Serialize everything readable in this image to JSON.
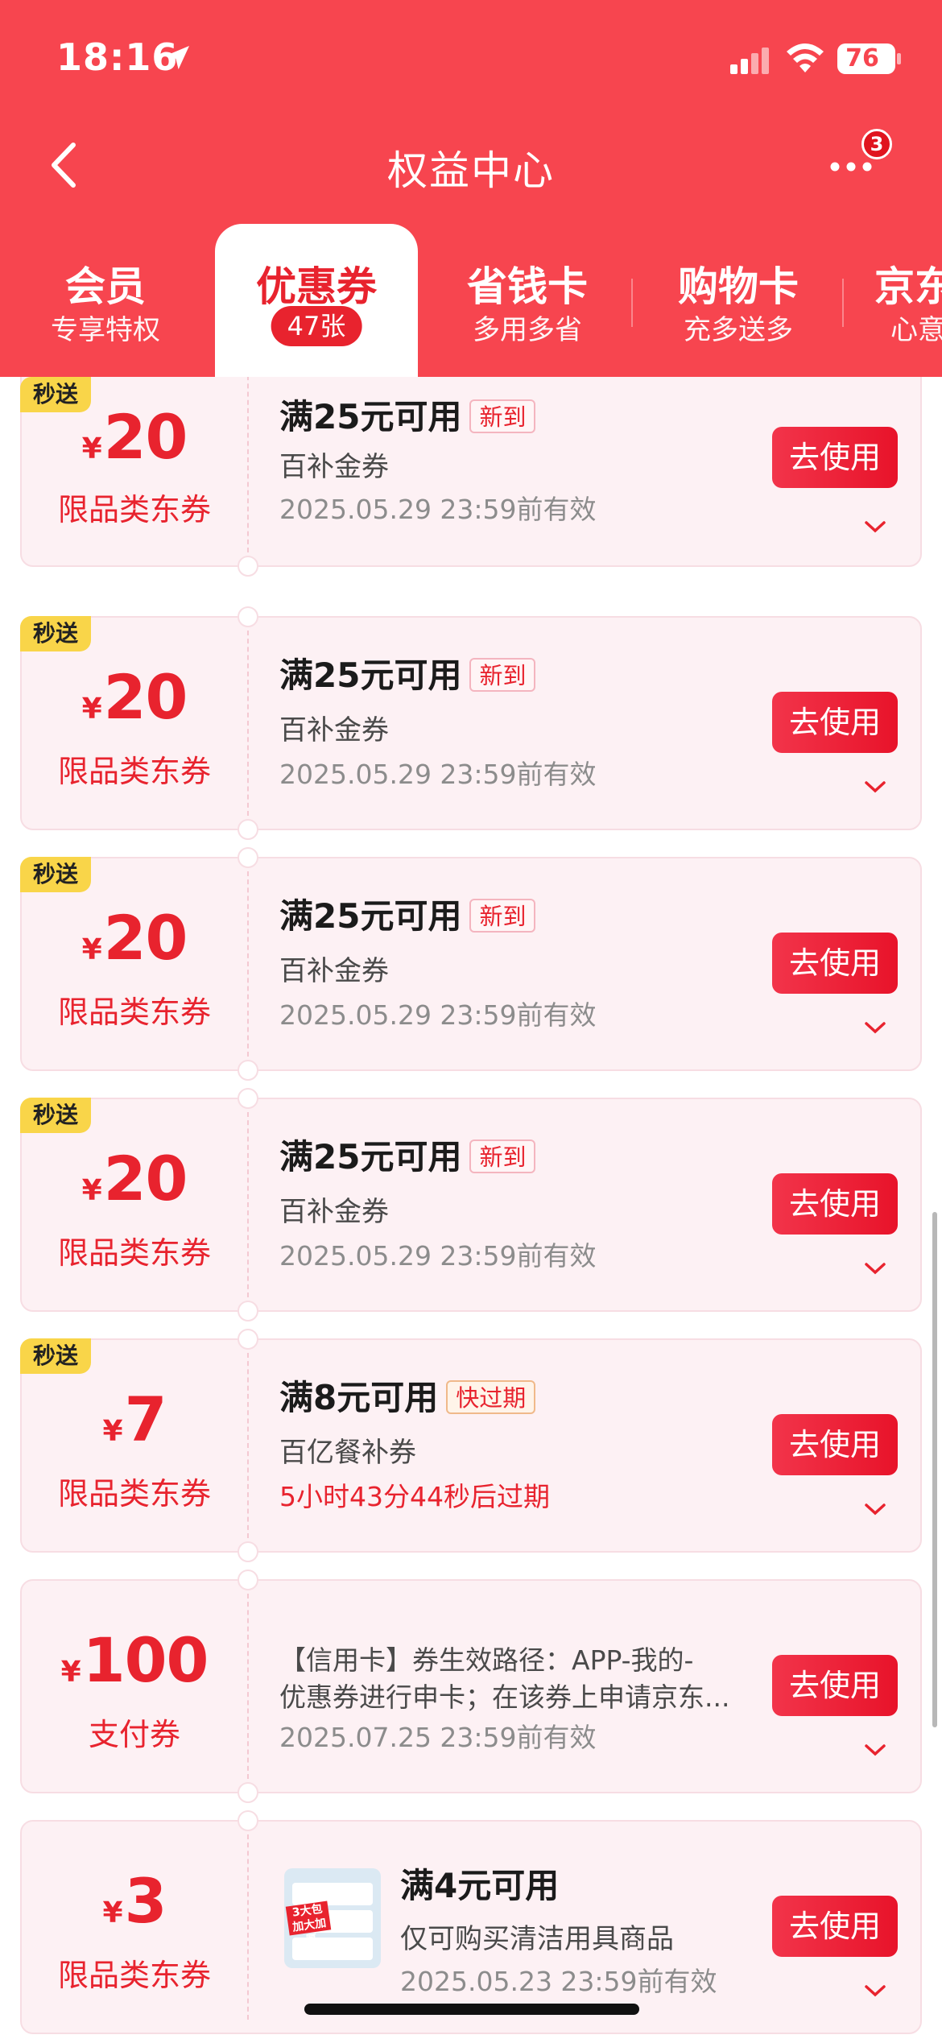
{
  "status_bar": {
    "time": "18:16",
    "battery": "76"
  },
  "header": {
    "title": "权益中心",
    "more_badge": "3"
  },
  "tabs": [
    {
      "title": "会员",
      "sub": "专享特权"
    },
    {
      "title": "优惠券",
      "sub": "47张"
    },
    {
      "title": "省钱卡",
      "sub": "多用多省"
    },
    {
      "title": "购物卡",
      "sub": "充多送多"
    },
    {
      "title": "京东",
      "sub": "心意"
    }
  ],
  "coupons": [
    {
      "tag": "秒送",
      "yen": "¥",
      "amount": "20",
      "type": "限品类东券",
      "condition": "满25元可用",
      "badge": "新到",
      "name": "百补金券",
      "validity": "2025.05.29 23:59前有效",
      "button": "去使用"
    },
    {
      "tag": "秒送",
      "yen": "¥",
      "amount": "20",
      "type": "限品类东券",
      "condition": "满25元可用",
      "badge": "新到",
      "name": "百补金券",
      "validity": "2025.05.29 23:59前有效",
      "button": "去使用"
    },
    {
      "tag": "秒送",
      "yen": "¥",
      "amount": "20",
      "type": "限品类东券",
      "condition": "满25元可用",
      "badge": "新到",
      "name": "百补金券",
      "validity": "2025.05.29 23:59前有效",
      "button": "去使用"
    },
    {
      "tag": "秒送",
      "yen": "¥",
      "amount": "20",
      "type": "限品类东券",
      "condition": "满25元可用",
      "badge": "新到",
      "name": "百补金券",
      "validity": "2025.05.29 23:59前有效",
      "button": "去使用"
    },
    {
      "tag": "秒送",
      "yen": "¥",
      "amount": "7",
      "type": "限品类东券",
      "condition": "满8元可用",
      "badge": "快过期",
      "name": "百亿餐补券",
      "validity": "5小时43分44秒后过期",
      "button": "去使用"
    },
    {
      "yen": "¥",
      "amount": "100",
      "type": "支付券",
      "desc_line1": "【信用卡】券生效路径：APP-我的-",
      "desc_line2": "优惠券进行申卡；在该券上申请京东...",
      "validity": "2025.07.25 23:59前有效",
      "button": "去使用"
    },
    {
      "yen": "¥",
      "amount": "3",
      "type": "限品类东券",
      "condition": "满4元可用",
      "name": "仅可购买清洁用具商品",
      "validity": "2025.05.23 23:59前有效",
      "button": "去使用",
      "image_label": "3大包 加大加厚"
    }
  ],
  "colors": {
    "header": "#f7454f",
    "accent": "#e8232e",
    "coupon_bg": "#fdf1f4",
    "tag_yellow": "#f9d549"
  },
  "icons": [
    "location-arrow-icon",
    "signal-icon",
    "wifi-icon",
    "battery-icon",
    "back-icon",
    "more-icon",
    "chevron-down-icon"
  ]
}
